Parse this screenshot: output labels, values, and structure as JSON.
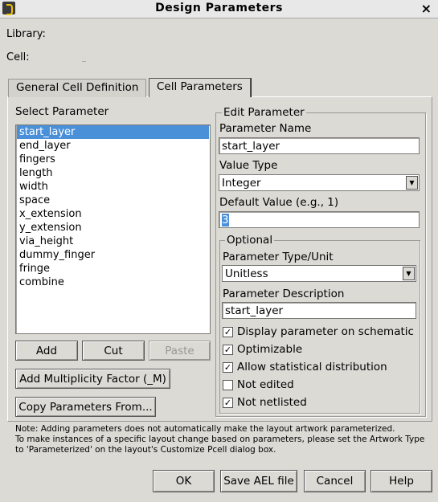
{
  "window": {
    "title": "Design Parameters",
    "close_glyph": "×"
  },
  "header": {
    "library_label": "Library:",
    "cell_label": "Cell:"
  },
  "tabs": [
    {
      "label": "General Cell Definition",
      "active": false
    },
    {
      "label": "Cell Parameters",
      "active": true
    }
  ],
  "select_parameter": {
    "heading": "Select Parameter",
    "items": [
      "start_layer",
      "end_layer",
      "fingers",
      "length",
      "width",
      "space",
      "x_extension",
      "y_extension",
      "via_height",
      "dummy_finger",
      "fringe",
      "combine"
    ],
    "selected": "start_layer"
  },
  "buttons": {
    "add": "Add",
    "cut": "Cut",
    "paste": "Paste",
    "multiplicity": "Add Multiplicity Factor (_M)",
    "copy_from": "Copy Parameters From...",
    "ok": "OK",
    "save_ael": "Save AEL file",
    "cancel": "Cancel",
    "help": "Help"
  },
  "edit_parameter": {
    "legend": "Edit Parameter",
    "name_label": "Parameter Name",
    "name_value": "start_layer",
    "value_type_label": "Value Type",
    "value_type": "Integer",
    "default_label": "Default Value (e.g., 1)",
    "default_value": "3"
  },
  "optional": {
    "legend": "Optional",
    "type_unit_label": "Parameter Type/Unit",
    "type_unit": "Unitless",
    "description_label": "Parameter Description",
    "description": "start_layer",
    "checks": [
      {
        "label": "Display parameter on schematic",
        "checked": true
      },
      {
        "label": "Optimizable",
        "checked": true
      },
      {
        "label": "Allow statistical distribution",
        "checked": true
      },
      {
        "label": "Not edited",
        "checked": false
      },
      {
        "label": "Not netlisted",
        "checked": true
      }
    ]
  },
  "note": {
    "line1": "Note: Adding parameters does not automatically make the layout artwork parameterized.",
    "line2": "To make instances of a specific layout change based on parameters, please set the Artwork Type",
    "line3": "to 'Parameterized' on the layout's Customize Pcell dialog box."
  },
  "icons": {
    "app": "app-logo-icon",
    "dropdown": "chevron-down-icon",
    "check": "checkmark-icon"
  },
  "colors": {
    "selection": "#4a90d9",
    "background": "#dcdad5"
  }
}
